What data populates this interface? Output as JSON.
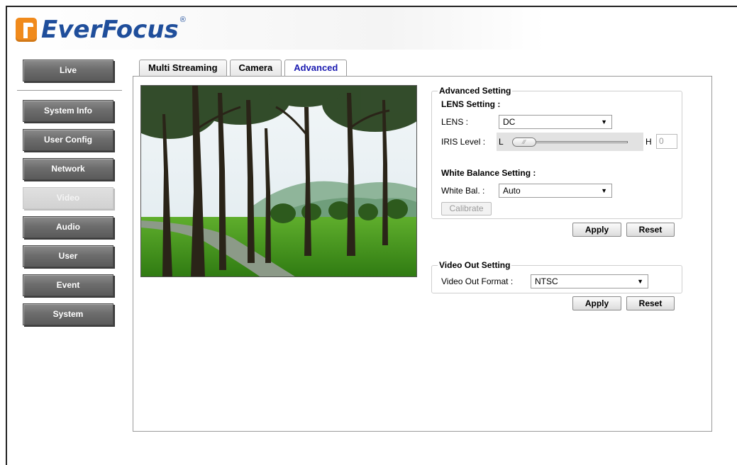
{
  "brand": {
    "name": "EverFocus",
    "reg_mark": "®"
  },
  "sidebar": {
    "items": [
      {
        "label": "Live"
      },
      {
        "label": "System Info"
      },
      {
        "label": "User Config"
      },
      {
        "label": "Network"
      },
      {
        "label": "Video"
      },
      {
        "label": "Audio"
      },
      {
        "label": "User"
      },
      {
        "label": "Event"
      },
      {
        "label": "System"
      }
    ],
    "active": "Video"
  },
  "tabs": [
    {
      "label": "Multi Streaming"
    },
    {
      "label": "Camera"
    },
    {
      "label": "Advanced"
    }
  ],
  "active_tab": "Advanced",
  "advanced": {
    "legend": "Advanced Setting",
    "lens_title": "LENS Setting :",
    "lens_label": "LENS :",
    "lens_value": "DC",
    "iris_label": "IRIS Level :",
    "iris_low": "L",
    "iris_high": "H",
    "iris_value": "0",
    "wb_title": "White Balance Setting :",
    "wb_label": "White Bal. :",
    "wb_value": "Auto",
    "calibrate_label": "Calibrate",
    "apply_label": "Apply",
    "reset_label": "Reset"
  },
  "video_out": {
    "legend": "Video Out Setting",
    "format_label": "Video Out Format :",
    "format_value": "NTSC",
    "apply_label": "Apply",
    "reset_label": "Reset"
  },
  "icons": {
    "dropdown": "chevron-down-icon",
    "logo": "everfocus-logo-icon"
  },
  "colors": {
    "brand_blue": "#1f4e9b",
    "brand_orange": "#f08a1c",
    "active_tab_text": "#1a1ab0"
  }
}
